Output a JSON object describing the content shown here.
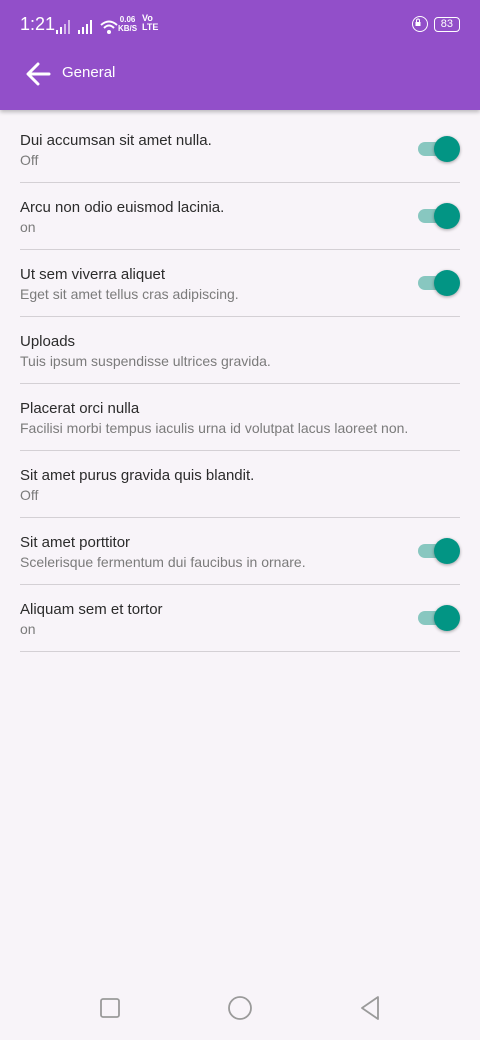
{
  "status_bar": {
    "time": "1:21",
    "net_speed_value": "0.06",
    "net_speed_unit": "KB/S",
    "volte_top": "Vo",
    "volte_bottom": "LTE",
    "battery": "83"
  },
  "app_bar": {
    "title": "General",
    "color": "#924fc9"
  },
  "settings": [
    {
      "title": "Dui accumsan sit amet nulla.",
      "summary": "Off",
      "has_switch": true,
      "switch_on": true
    },
    {
      "title": "Arcu non odio euismod lacinia.",
      "summary": "on",
      "has_switch": true,
      "switch_on": true
    },
    {
      "title": "Ut sem viverra aliquet",
      "summary": "Eget sit amet tellus cras adipiscing.",
      "has_switch": true,
      "switch_on": true
    },
    {
      "title": "Uploads",
      "summary": "Tuis ipsum suspendisse ultrices gravida.",
      "has_switch": false
    },
    {
      "title": "Placerat orci nulla",
      "summary": "Facilisi morbi tempus iaculis urna id volutpat lacus laoreet non.",
      "has_switch": false
    },
    {
      "title": "Sit amet purus gravida quis blandit.",
      "summary": "Off",
      "has_switch": false
    },
    {
      "title": "Sit amet porttitor",
      "summary": "Scelerisque fermentum dui faucibus in ornare.",
      "has_switch": true,
      "switch_on": true
    },
    {
      "title": "Aliquam sem et tortor",
      "summary": "on",
      "has_switch": true,
      "switch_on": true
    }
  ],
  "colors": {
    "switch_thumb": "#029584",
    "switch_track": "#88c7c0",
    "background": "#f8f4f9"
  },
  "nav_icons": [
    "recents-square-icon",
    "home-circle-icon",
    "back-triangle-icon"
  ]
}
